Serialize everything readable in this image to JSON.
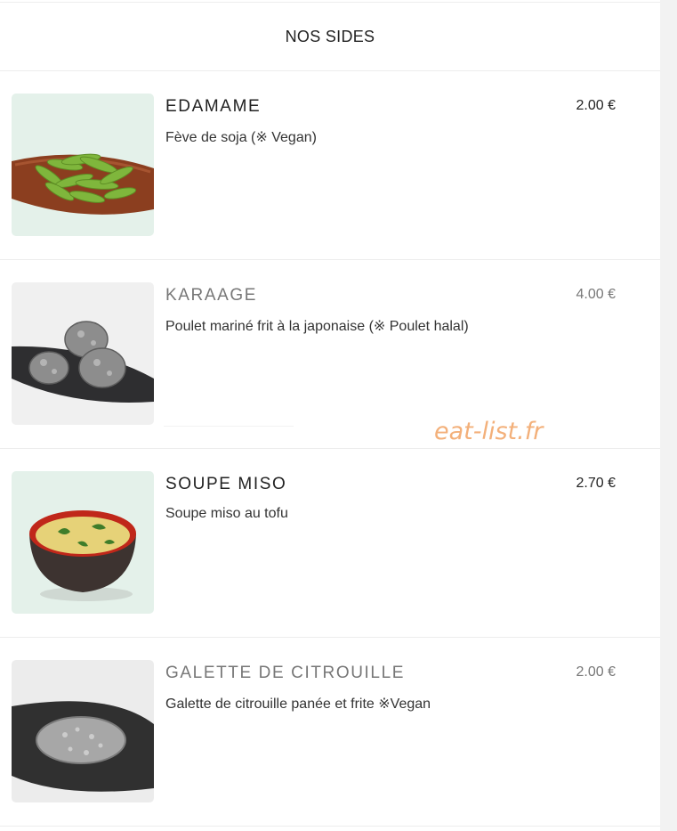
{
  "section": {
    "title": "NOS SIDES"
  },
  "items": [
    {
      "name": "EDAMAME",
      "description": "Fève de soja (※ Vegan)",
      "price": "2.00 €",
      "image_icon": "edamame-image"
    },
    {
      "name": "KARAAGE",
      "description": "Poulet mariné frit à la japonaise (※ Poulet halal)",
      "price": "4.00 €",
      "image_icon": "karaage-image"
    },
    {
      "name": "SOUPE MISO",
      "description": "Soupe miso au tofu",
      "price": "2.70 €",
      "image_icon": "miso-soup-image"
    },
    {
      "name": "GALETTE DE CITROUILLE",
      "description": "Galette de citrouille panée et frite ※Vegan",
      "price": "2.00 €",
      "image_icon": "pumpkin-galette-image"
    }
  ],
  "watermark": "eat-list.fr",
  "colors": {
    "watermark": "#f3b07a",
    "muted_title": "#777777",
    "divider": "#ececec"
  }
}
